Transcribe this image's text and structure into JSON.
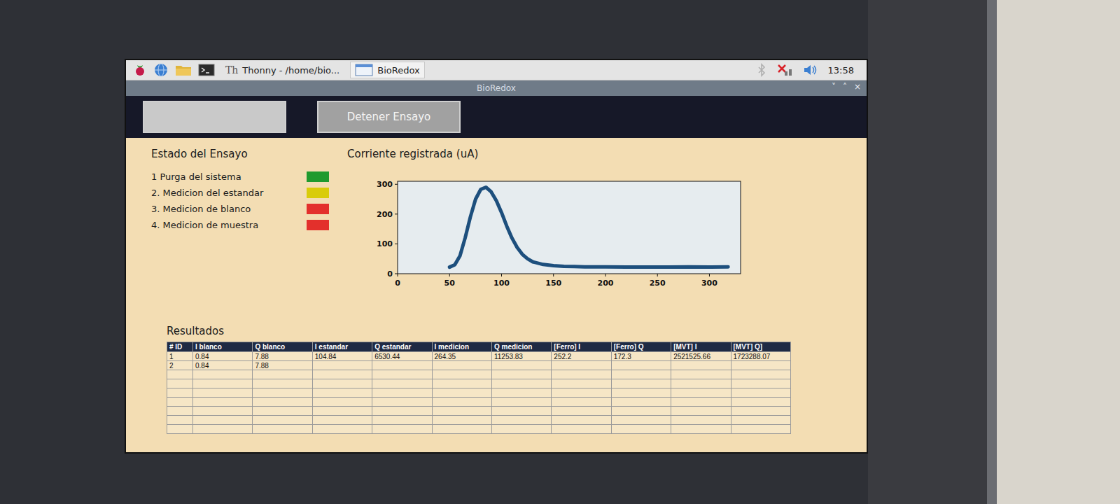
{
  "taskbar": {
    "thonny_icon_text": "Th",
    "thonny_task": "Thonny - /home/bio...",
    "app_task": "BioRedox",
    "clock": "13:58"
  },
  "window": {
    "title": "BioRedox",
    "controls": [
      "˅",
      "˄",
      "×"
    ]
  },
  "toolbar": {
    "buttons": [
      {
        "label": ""
      },
      {
        "label": "Detener Ensayo"
      }
    ]
  },
  "status": {
    "title": "Estado del Ensayo",
    "steps": [
      {
        "label": "1 Purga del sistema",
        "color": "#1f9a2e"
      },
      {
        "label": "2. Medicion del estandar",
        "color": "#d9cc0a"
      },
      {
        "label": "3. Medicion de blanco",
        "color": "#e3302c"
      },
      {
        "label": "4. Medicion de muestra",
        "color": "#e3302c"
      }
    ]
  },
  "chart": {
    "title": "Corriente registrada (uA)",
    "y_ticks": [
      "0",
      "100",
      "200",
      "300"
    ],
    "x_ticks": [
      "0",
      "50",
      "100",
      "150",
      "200",
      "250",
      "300"
    ],
    "series": [
      {
        "x": [
          50,
          55,
          60,
          65,
          70,
          75,
          80,
          85,
          90,
          95,
          100,
          105,
          110,
          115,
          120,
          125,
          130,
          140,
          150,
          160,
          170,
          180,
          200,
          220,
          240,
          260,
          280,
          300,
          318
        ],
        "y": [
          22,
          30,
          60,
          120,
          190,
          250,
          283,
          290,
          275,
          245,
          205,
          160,
          120,
          88,
          65,
          50,
          40,
          31,
          27,
          25,
          24,
          23,
          23,
          22,
          22,
          22,
          23,
          22,
          23
        ]
      }
    ]
  },
  "results": {
    "title": "Resultados",
    "columns": [
      "# ID",
      "I blanco",
      "Q blanco",
      "I estandar",
      "Q estandar",
      "I medicion",
      "Q medicion",
      "[Ferro] I",
      "[Ferro] Q",
      "[MVT] I",
      "[MVT] Q]"
    ],
    "rows": [
      [
        "1",
        "0.84",
        "7.88",
        "104.84",
        "6530.44",
        "264.35",
        "11253.83",
        "252.2",
        "172.3",
        "2521525.66",
        "1723288.07"
      ],
      [
        "2",
        "0.84",
        "7.88",
        "",
        "",
        "",
        "",
        "",
        "",
        "",
        ""
      ],
      [
        "",
        "",
        "",
        "",
        "",
        "",
        "",
        "",
        "",
        "",
        ""
      ],
      [
        "",
        "",
        "",
        "",
        "",
        "",
        "",
        "",
        "",
        "",
        ""
      ],
      [
        "",
        "",
        "",
        "",
        "",
        "",
        "",
        "",
        "",
        "",
        ""
      ],
      [
        "",
        "",
        "",
        "",
        "",
        "",
        "",
        "",
        "",
        "",
        ""
      ],
      [
        "",
        "",
        "",
        "",
        "",
        "",
        "",
        "",
        "",
        "",
        ""
      ],
      [
        "",
        "",
        "",
        "",
        "",
        "",
        "",
        "",
        "",
        "",
        ""
      ],
      [
        "",
        "",
        "",
        "",
        "",
        "",
        "",
        "",
        "",
        "",
        ""
      ]
    ]
  }
}
